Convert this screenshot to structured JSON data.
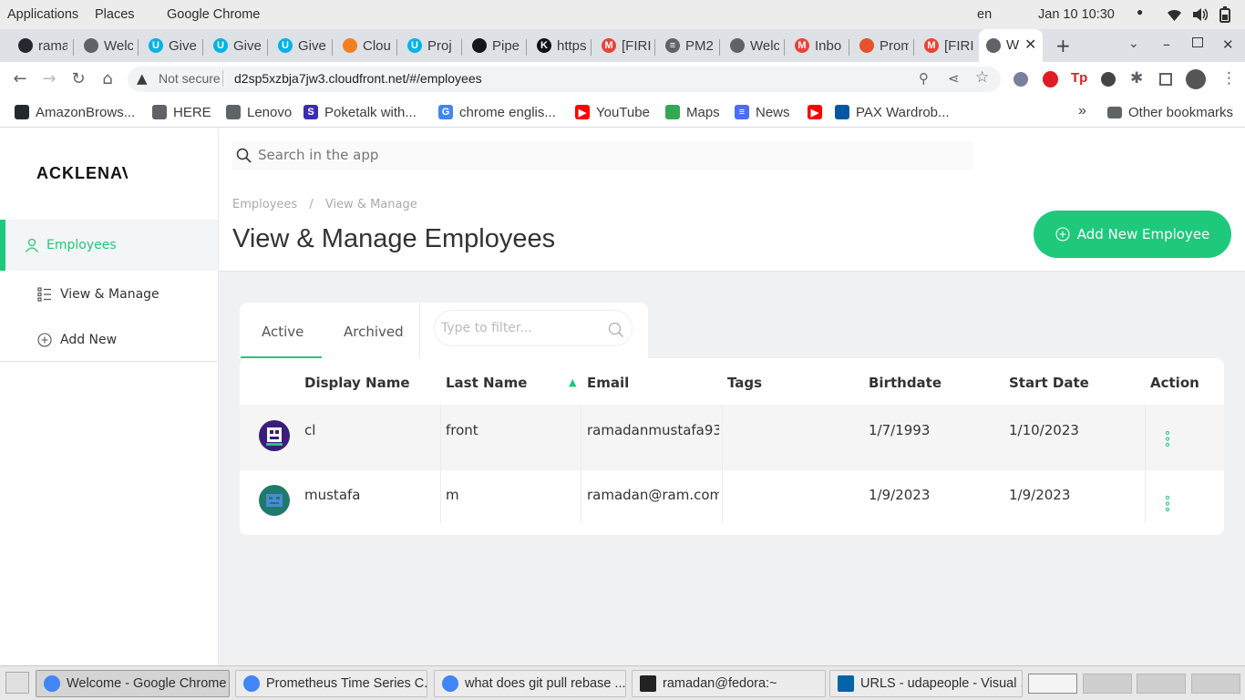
{
  "system_bar": {
    "applications": "Applications",
    "places": "Places",
    "active_app": "Google Chrome",
    "lang": "en",
    "datetime": "Jan 10  10:30"
  },
  "tabs": [
    {
      "label": "rama",
      "icon": "github-icon"
    },
    {
      "label": "Welc",
      "icon": "globe-icon"
    },
    {
      "label": "Give",
      "icon": "u-logo-icon"
    },
    {
      "label": "Give",
      "icon": "u-logo-icon"
    },
    {
      "label": "Give",
      "icon": "u-logo-icon"
    },
    {
      "label": "Clou",
      "icon": "cube-icon"
    },
    {
      "label": "Proj",
      "icon": "u-logo-icon"
    },
    {
      "label": "Pipe",
      "icon": "circleci-icon"
    },
    {
      "label": "https",
      "icon": "k-icon"
    },
    {
      "label": "[FIRI",
      "icon": "gmail-icon"
    },
    {
      "label": "PM2",
      "icon": "menu-icon"
    },
    {
      "label": "Welc",
      "icon": "globe-icon"
    },
    {
      "label": "Inbo",
      "icon": "gmail-icon"
    },
    {
      "label": "Prom",
      "icon": "flame-icon"
    },
    {
      "label": "[FIRI",
      "icon": "gmail-icon"
    }
  ],
  "active_tab": {
    "label": "W"
  },
  "address_bar": {
    "security": "Not secure",
    "url": "d2sp5xzbja7jw3.cloudfront.net/#/employees"
  },
  "bookmarks": [
    {
      "label": "AmazonBrows...",
      "icon": "github-icon"
    },
    {
      "label": "HERE",
      "icon": "globe-icon"
    },
    {
      "label": "Lenovo",
      "icon": "folder-icon"
    },
    {
      "label": "Poketalk with...",
      "icon": "s-logo-icon"
    },
    {
      "label": "chrome englis...",
      "icon": "google-icon"
    },
    {
      "label": "YouTube",
      "icon": "youtube-icon"
    },
    {
      "label": "Maps",
      "icon": "maps-icon"
    },
    {
      "label": "News",
      "icon": "news-icon"
    },
    {
      "label": "",
      "icon": "youtube-icon"
    },
    {
      "label": "PAX Wardrob...",
      "icon": "ikea-icon"
    }
  ],
  "other_bookmarks": "Other bookmarks",
  "app": {
    "logo": "ACKLENAV",
    "search_placeholder": "Search in the app",
    "nav": {
      "employees": "Employees",
      "view_manage": "View & Manage",
      "add_new": "Add New"
    },
    "breadcrumb": {
      "root": "Employees",
      "sep": "/",
      "current": "View & Manage"
    },
    "page_title": "View & Manage Employees",
    "add_button": "Add New Employee",
    "tabs": {
      "active": "Active",
      "archived": "Archived"
    },
    "filter_placeholder": "Type to filter...",
    "columns": {
      "display_name": "Display Name",
      "last_name": "Last Name",
      "email": "Email",
      "tags": "Tags",
      "birthdate": "Birthdate",
      "start_date": "Start Date",
      "action": "Action"
    },
    "sort_indicator": "▲",
    "rows": [
      {
        "display_name": "cl",
        "last_name": "front",
        "email": "ramadanmustafa93...",
        "tags": "",
        "birthdate": "1/7/1993",
        "start_date": "1/10/2023"
      },
      {
        "display_name": "mustafa",
        "last_name": "m",
        "email": "ramadan@ram.com",
        "tags": "",
        "birthdate": "1/9/2023",
        "start_date": "1/9/2023"
      }
    ],
    "accent_color": "#1ec97c"
  },
  "taskbar": [
    {
      "label": "Welcome - Google Chrome"
    },
    {
      "label": "Prometheus Time Series C..."
    },
    {
      "label": "what does git pull rebase ..."
    },
    {
      "label": "ramadan@fedora:~"
    },
    {
      "label": "URLS - udapeople - Visual ..."
    }
  ]
}
